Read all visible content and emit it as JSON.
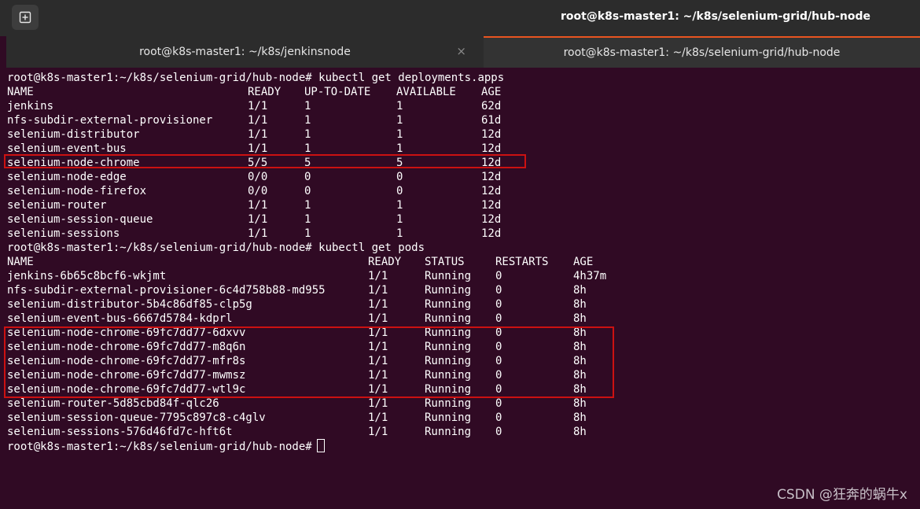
{
  "window": {
    "title": "root@k8s-master1: ~/k8s/selenium-grid/hub-node",
    "new_tab_icon": "new-tab-icon"
  },
  "tabs": [
    {
      "label": "root@k8s-master1: ~/k8s/jenkinsnode",
      "close": "×"
    },
    {
      "label": "root@k8s-master1: ~/k8s/selenium-grid/hub-node"
    }
  ],
  "terminal": {
    "prompt1": "root@k8s-master1:~/k8s/selenium-grid/hub-node# kubectl get deployments.apps",
    "deploy_headers": [
      "NAME",
      "READY",
      "UP-TO-DATE",
      "AVAILABLE",
      "AGE"
    ],
    "deployments": [
      [
        "jenkins",
        "1/1",
        "1",
        "1",
        "62d"
      ],
      [
        "nfs-subdir-external-provisioner",
        "1/1",
        "1",
        "1",
        "61d"
      ],
      [
        "selenium-distributor",
        "1/1",
        "1",
        "1",
        "12d"
      ],
      [
        "selenium-event-bus",
        "1/1",
        "1",
        "1",
        "12d"
      ],
      [
        "selenium-node-chrome",
        "5/5",
        "5",
        "5",
        "12d"
      ],
      [
        "selenium-node-edge",
        "0/0",
        "0",
        "0",
        "12d"
      ],
      [
        "selenium-node-firefox",
        "0/0",
        "0",
        "0",
        "12d"
      ],
      [
        "selenium-router",
        "1/1",
        "1",
        "1",
        "12d"
      ],
      [
        "selenium-session-queue",
        "1/1",
        "1",
        "1",
        "12d"
      ],
      [
        "selenium-sessions",
        "1/1",
        "1",
        "1",
        "12d"
      ]
    ],
    "prompt2": "root@k8s-master1:~/k8s/selenium-grid/hub-node# kubectl get pods",
    "pod_headers": [
      "NAME",
      "READY",
      "STATUS",
      "RESTARTS",
      "AGE"
    ],
    "pods": [
      [
        "jenkins-6b65c8bcf6-wkjmt",
        "1/1",
        "Running",
        "0",
        "4h37m"
      ],
      [
        "nfs-subdir-external-provisioner-6c4d758b88-md955",
        "1/1",
        "Running",
        "0",
        "8h"
      ],
      [
        "selenium-distributor-5b4c86df85-clp5g",
        "1/1",
        "Running",
        "0",
        "8h"
      ],
      [
        "selenium-event-bus-6667d5784-kdprl",
        "1/1",
        "Running",
        "0",
        "8h"
      ],
      [
        "selenium-node-chrome-69fc7dd77-6dxvv",
        "1/1",
        "Running",
        "0",
        "8h"
      ],
      [
        "selenium-node-chrome-69fc7dd77-m8q6n",
        "1/1",
        "Running",
        "0",
        "8h"
      ],
      [
        "selenium-node-chrome-69fc7dd77-mfr8s",
        "1/1",
        "Running",
        "0",
        "8h"
      ],
      [
        "selenium-node-chrome-69fc7dd77-mwmsz",
        "1/1",
        "Running",
        "0",
        "8h"
      ],
      [
        "selenium-node-chrome-69fc7dd77-wtl9c",
        "1/1",
        "Running",
        "0",
        "8h"
      ],
      [
        "selenium-router-5d85cbd84f-qlc26",
        "1/1",
        "Running",
        "0",
        "8h"
      ],
      [
        "selenium-session-queue-7795c897c8-c4glv",
        "1/1",
        "Running",
        "0",
        "8h"
      ],
      [
        "selenium-sessions-576d46fd7c-hft6t",
        "1/1",
        "Running",
        "0",
        "8h"
      ]
    ],
    "prompt3": "root@k8s-master1:~/k8s/selenium-grid/hub-node#"
  },
  "watermark": "CSDN @狂奔的蜗牛x",
  "colors": {
    "terminal_bg": "#300a24",
    "highlight_border": "#cc1111",
    "active_tab_accent": "#e95420"
  }
}
